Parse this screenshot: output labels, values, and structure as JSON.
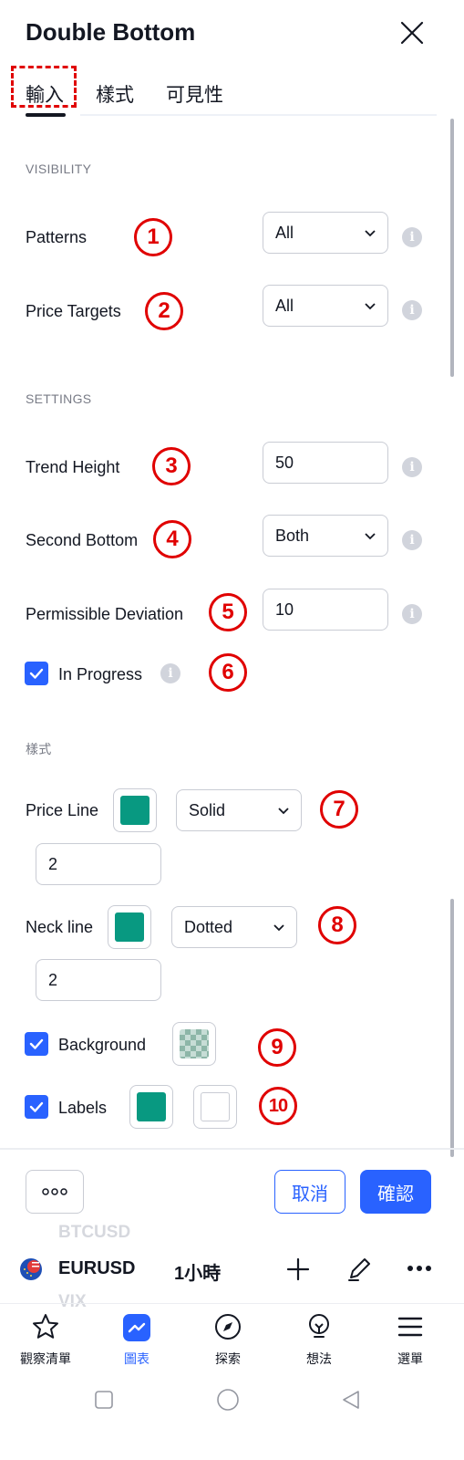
{
  "dialog": {
    "title": "Double Bottom",
    "tabs": [
      {
        "label": "輸入",
        "active": true
      },
      {
        "label": "樣式",
        "active": false
      },
      {
        "label": "可見性",
        "active": false
      }
    ]
  },
  "sections": {
    "visibility": "VISIBILITY",
    "settings": "SETTINGS",
    "style": "樣式"
  },
  "fields": {
    "patterns": {
      "label": "Patterns",
      "value": "All",
      "badge": "1"
    },
    "price_targets": {
      "label": "Price Targets",
      "value": "All",
      "badge": "2"
    },
    "trend_height": {
      "label": "Trend Height",
      "value": "50",
      "badge": "3"
    },
    "second_bottom": {
      "label": "Second Bottom",
      "value": "Both",
      "badge": "4"
    },
    "permissible_deviation": {
      "label": "Permissible Deviation",
      "value": "10",
      "badge": "5"
    },
    "in_progress": {
      "label": "In Progress",
      "checked": true,
      "badge": "6"
    },
    "price_line": {
      "label": "Price Line",
      "color": "#089981",
      "style": "Solid",
      "width": "2",
      "badge": "7"
    },
    "neck_line": {
      "label": "Neck line",
      "color": "#089981",
      "style": "Dotted",
      "width": "2",
      "badge": "8"
    },
    "background": {
      "label": "Background",
      "checked": true,
      "badge": "9"
    },
    "labels": {
      "label": "Labels",
      "checked": true,
      "color": "#089981",
      "text_color": "#ffffff",
      "badge": "10"
    }
  },
  "footer": {
    "cancel": "取消",
    "confirm": "確認"
  },
  "symbol_bar": {
    "ghost_above": "BTCUSD",
    "symbol": "EURUSD",
    "interval": "1小時",
    "ghost_below": "VIX"
  },
  "bottom_nav": [
    {
      "label": "觀察清單",
      "icon": "star-icon",
      "active": false
    },
    {
      "label": "圖表",
      "icon": "chart-icon",
      "active": true
    },
    {
      "label": "探索",
      "icon": "compass-icon",
      "active": false
    },
    {
      "label": "想法",
      "icon": "lightbulb-icon",
      "active": false
    },
    {
      "label": "選單",
      "icon": "menu-icon",
      "active": false
    }
  ],
  "colors": {
    "accent": "#2962ff",
    "annotation": "#e00000",
    "swatch": "#089981"
  }
}
